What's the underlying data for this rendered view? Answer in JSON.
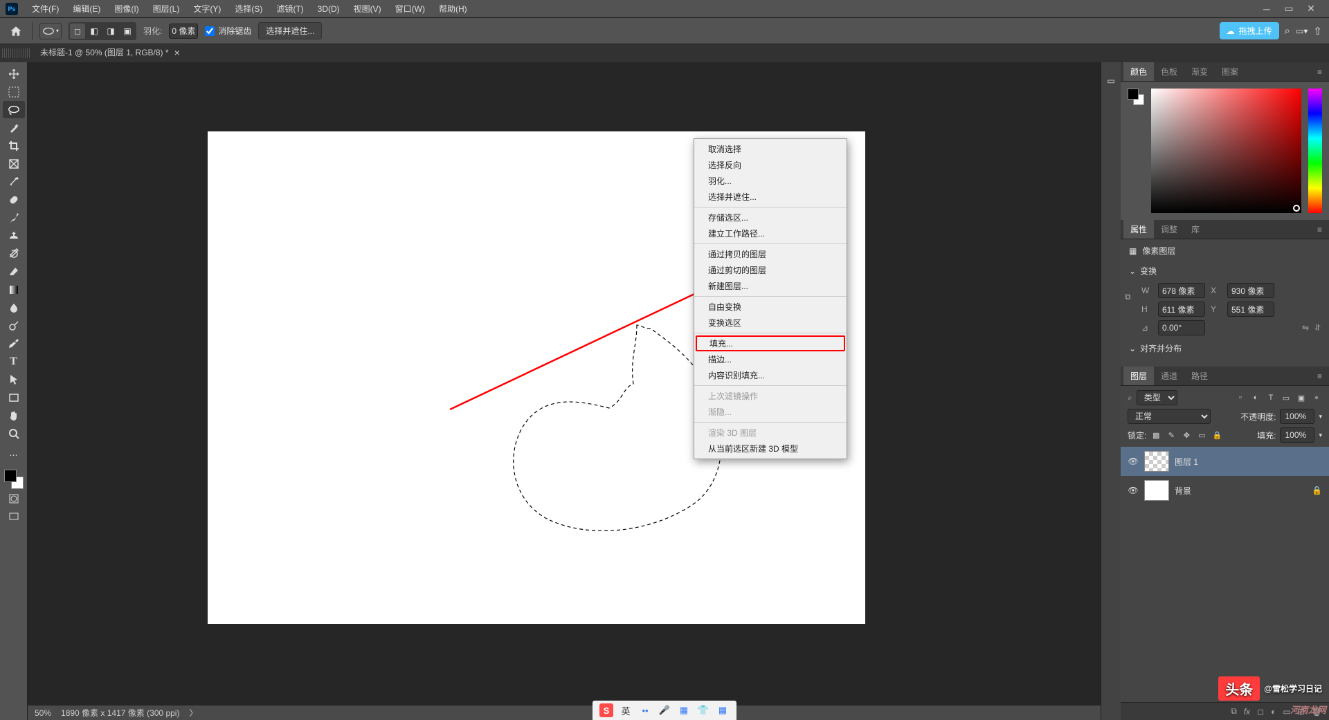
{
  "menubar": {
    "items": [
      "文件(F)",
      "编辑(E)",
      "图像(I)",
      "图层(L)",
      "文字(Y)",
      "选择(S)",
      "滤镜(T)",
      "3D(D)",
      "视图(V)",
      "窗口(W)",
      "帮助(H)"
    ]
  },
  "optionsbar": {
    "feather_label": "羽化:",
    "feather_value": "0 像素",
    "antialias_label": "消除锯齿",
    "select_mask_label": "选择并遮住...",
    "cloud_upload": "拖拽上传"
  },
  "document": {
    "tab_title": "未标题-1 @ 50% (图层 1, RGB/8) *"
  },
  "context_menu": {
    "items": [
      {
        "label": "取消选择",
        "enabled": true
      },
      {
        "label": "选择反向",
        "enabled": true
      },
      {
        "label": "羽化...",
        "enabled": true
      },
      {
        "label": "选择并遮住...",
        "enabled": true
      },
      {
        "sep": true
      },
      {
        "label": "存储选区...",
        "enabled": true
      },
      {
        "label": "建立工作路径...",
        "enabled": true
      },
      {
        "sep": true
      },
      {
        "label": "通过拷贝的图层",
        "enabled": true
      },
      {
        "label": "通过剪切的图层",
        "enabled": true
      },
      {
        "label": "新建图层...",
        "enabled": true
      },
      {
        "sep": true
      },
      {
        "label": "自由变换",
        "enabled": true
      },
      {
        "label": "变换选区",
        "enabled": true
      },
      {
        "sep": true
      },
      {
        "label": "填充...",
        "enabled": true,
        "highlight": true
      },
      {
        "label": "描边...",
        "enabled": true
      },
      {
        "label": "内容识别填充...",
        "enabled": true
      },
      {
        "sep": true
      },
      {
        "label": "上次滤镜操作",
        "enabled": false
      },
      {
        "label": "渐隐...",
        "enabled": false
      },
      {
        "sep": true
      },
      {
        "label": "渲染 3D 图层",
        "enabled": false
      },
      {
        "label": "从当前选区新建 3D 模型",
        "enabled": true
      }
    ]
  },
  "panels": {
    "color": {
      "tabs": [
        "颜色",
        "色板",
        "渐变",
        "图案"
      ]
    },
    "props": {
      "tabs": [
        "属性",
        "调整",
        "库"
      ],
      "type_label": "像素图层",
      "transform_label": "变换",
      "W": "678 像素",
      "X": "930 像素",
      "H": "611 像素",
      "Y": "551 像素",
      "angle": "0.00°",
      "align_label": "对齐并分布"
    },
    "layers": {
      "tabs": [
        "图层",
        "通道",
        "路径"
      ],
      "kind_label": "类型",
      "blend_mode": "正常",
      "opacity_label": "不透明度:",
      "opacity_value": "100%",
      "lock_label": "锁定:",
      "fill_label": "填充:",
      "fill_value": "100%",
      "items": [
        {
          "name": "图层 1",
          "active": true,
          "checker": true,
          "locked": false
        },
        {
          "name": "背景",
          "active": false,
          "checker": false,
          "locked": true
        }
      ]
    }
  },
  "status": {
    "zoom": "50%",
    "info": "1890 像素 x 1417 像素 (300 ppi)"
  },
  "watermark": {
    "brand": "头条",
    "author": "@雪松学习日记",
    "site": "河南龙网"
  },
  "taskbar": {
    "ime": "英"
  }
}
